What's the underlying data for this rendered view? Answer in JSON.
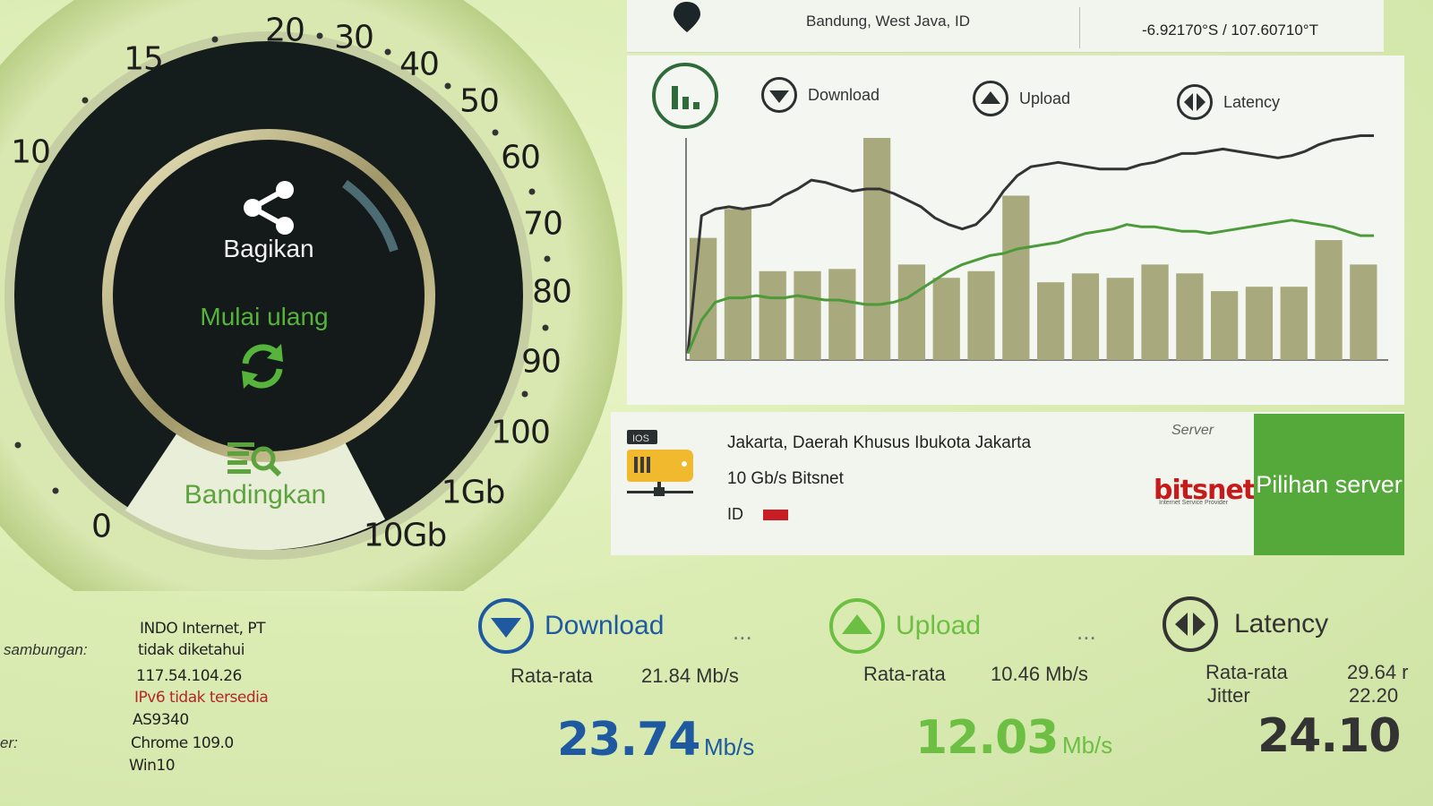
{
  "location": {
    "city": "Bandung, West Java, ID",
    "coords": "-6.92170°S / 107.60710°T"
  },
  "legend": {
    "download": "Download",
    "upload": "Upload",
    "latency": "Latency"
  },
  "gauge": {
    "ticks": [
      "0",
      "10",
      "15",
      "20",
      "30",
      "40",
      "50",
      "60",
      "70",
      "80",
      "90",
      "100",
      "1Gb",
      "10Gb"
    ],
    "share_label": "Bagikan",
    "restart_label": "Mulai ulang",
    "compare_label": "Bandingkan"
  },
  "server": {
    "city": "Jakarta, Daerah Khusus Ibukota Jakarta",
    "isp": "10 Gb/s Bitsnet",
    "country_code": "ID",
    "label": "Server",
    "logo_text": "bitsnet",
    "logo_subtext": "Internet Service Provider",
    "select_label": "Pilihan server"
  },
  "connection": {
    "type_label": "sambungan:",
    "browser_label": "er:",
    "isp": "INDO Internet, PT",
    "type": "tidak diketahui",
    "ipv4": "117.54.104.26",
    "ipv6": "IPv6 tidak tersedia",
    "asn": "AS9340",
    "browser": "Chrome 109.0",
    "os": "Win10"
  },
  "results": {
    "download": {
      "title": "Download",
      "more": "...",
      "avg_label": "Rata-rata",
      "avg": "21.84 Mb/s",
      "value": "23.74",
      "unit": "Mb/s"
    },
    "upload": {
      "title": "Upload",
      "more": "...",
      "avg_label": "Rata-rata",
      "avg": "10.46 Mb/s",
      "value": "12.03",
      "unit": "Mb/s"
    },
    "latency": {
      "title": "Latency",
      "avg_label": "Rata-rata",
      "avg": "29.64 r",
      "jitter_label": "Jitter",
      "jitter": "22.20",
      "value": "24.10"
    }
  },
  "colors": {
    "download": "#1f5aa0",
    "upload": "#6cbf42",
    "latency": "#333333",
    "accent_green": "#55a83a",
    "bars": "#a8a97c"
  },
  "chart_data": {
    "type": "bar",
    "bars": [
      55,
      68,
      40,
      40,
      41,
      100,
      43,
      37,
      40,
      74,
      35,
      39,
      37,
      43,
      39,
      31,
      33,
      33,
      54,
      43
    ],
    "series": [
      {
        "values": [
          3,
          65,
          68,
          69,
          68,
          69,
          70,
          74,
          77,
          81,
          80,
          78,
          76,
          77,
          77,
          75,
          72,
          69,
          64,
          61,
          59,
          61,
          67,
          76,
          83,
          87,
          88,
          89,
          88,
          87,
          86,
          86,
          86,
          88,
          89,
          91,
          93,
          93,
          94,
          95,
          94,
          93,
          92,
          91,
          92,
          94,
          97,
          99,
          100,
          101,
          101
        ]
      },
      {
        "values": [
          3,
          18,
          26,
          28,
          28,
          29,
          28,
          28,
          29,
          28,
          27,
          27,
          26,
          25,
          25,
          26,
          28,
          32,
          36,
          40,
          43,
          45,
          47,
          48,
          50,
          51,
          52,
          53,
          55,
          57,
          58,
          59,
          61,
          60,
          60,
          59,
          58,
          58,
          57,
          58,
          59,
          60,
          61,
          62,
          63,
          62,
          61,
          60,
          58,
          56,
          56
        ]
      }
    ],
    "ylim": [
      0,
      100
    ],
    "grid": false,
    "legend": "top"
  }
}
